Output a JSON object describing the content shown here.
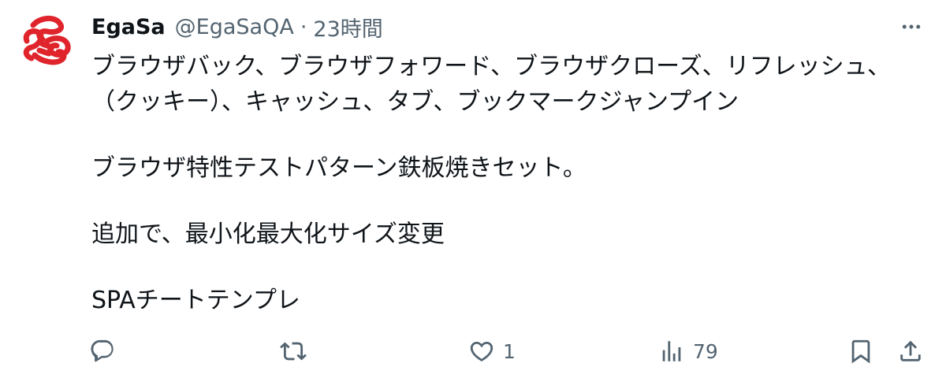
{
  "tweet": {
    "author_name": "EgaSa",
    "handle": "@EgaSaQA",
    "separator": "·",
    "time": "23時間",
    "lines": [
      "ブラウザバック、ブラウザフォワード、ブラウザクローズ、リフレッシュ、",
      "（クッキー）、キャッシュ、タブ、ブックマークジャンプイン",
      "",
      "ブラウザ特性テストパターン鉄板焼きセット。",
      "",
      "追加で、最小化最大化サイズ変更",
      "",
      "SPAチートテンプレ"
    ]
  },
  "actions": {
    "reply_count": "",
    "retweet_count": "",
    "like_count": "1",
    "views_count": "79"
  },
  "icons": {
    "avatar": "red-scribble-logo",
    "more": "more-horizontal-icon",
    "reply": "reply-icon",
    "retweet": "retweet-icon",
    "like": "heart-icon",
    "views": "views-bar-chart-icon",
    "bookmark": "bookmark-icon",
    "share": "share-icon"
  },
  "colors": {
    "text": "#0f1419",
    "secondary": "#536471",
    "avatar_red": "#e0242b"
  }
}
